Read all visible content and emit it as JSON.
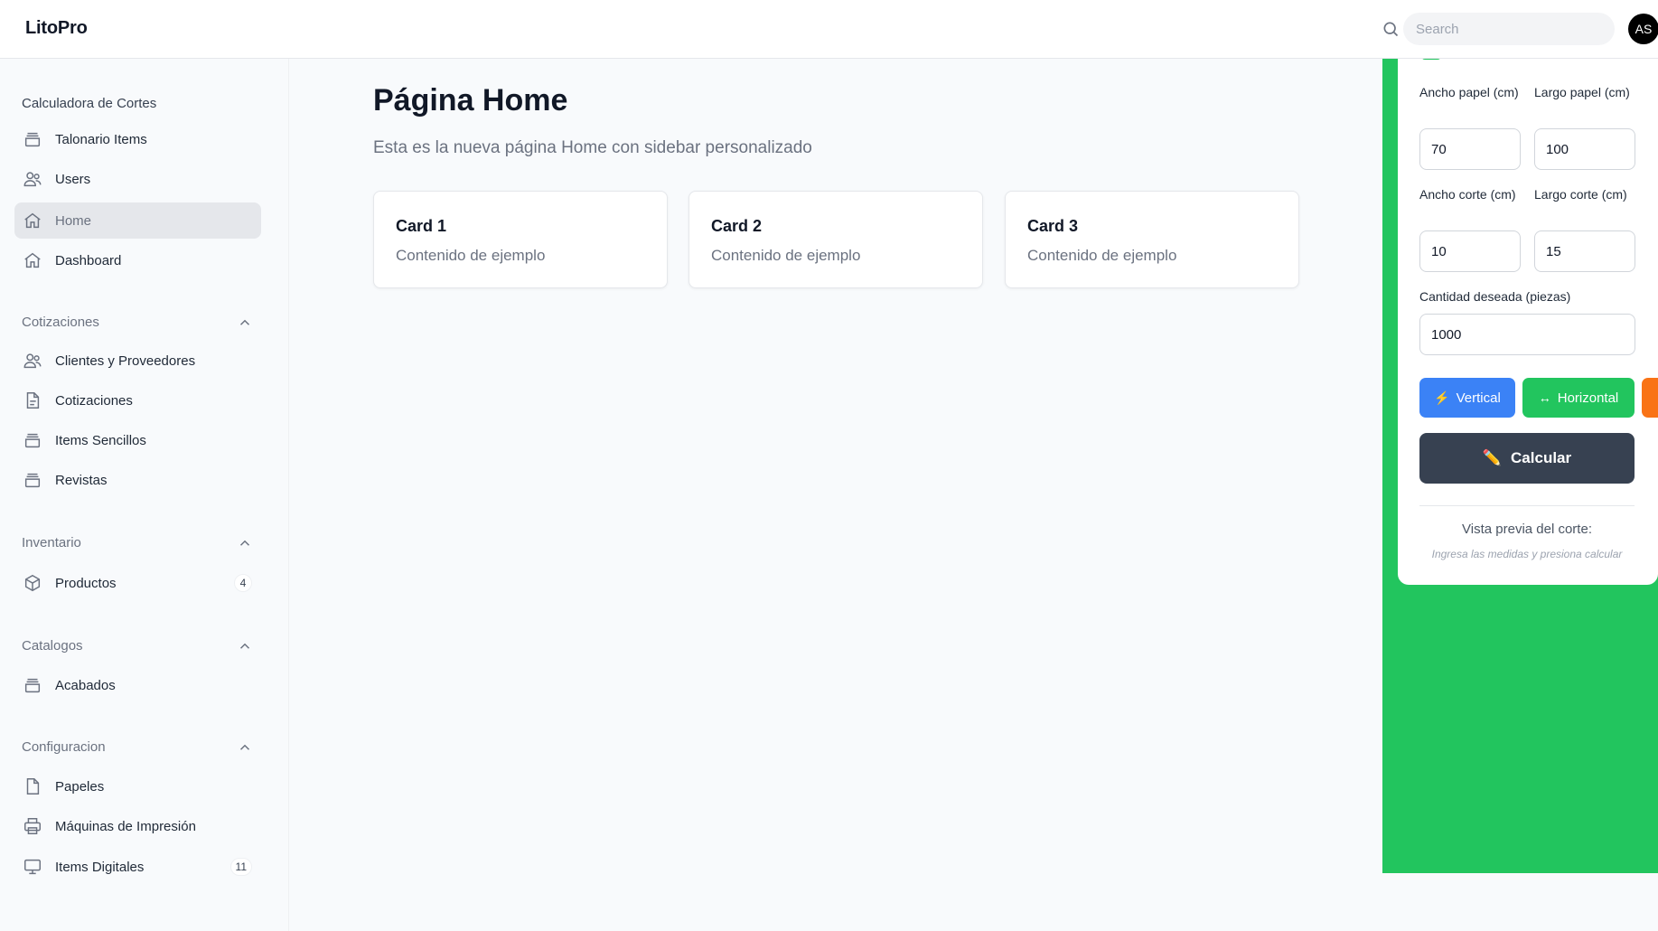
{
  "app": {
    "brand": "LitoPro"
  },
  "header": {
    "search_placeholder": "Search",
    "avatar_initials": "AS"
  },
  "sidebar": {
    "top_group_title": "Calculadora de Cortes",
    "top_items": [
      {
        "label": "Talonario Items",
        "icon": "archive-icon"
      },
      {
        "label": "Users",
        "icon": "users-icon"
      },
      {
        "label": "Home",
        "icon": "home-icon",
        "active": true
      },
      {
        "label": "Dashboard",
        "icon": "home-icon"
      }
    ],
    "groups": [
      {
        "label": "Cotizaciones",
        "items": [
          {
            "label": "Clientes y Proveedores",
            "icon": "users-icon"
          },
          {
            "label": "Cotizaciones",
            "icon": "document-icon"
          },
          {
            "label": "Items Sencillos",
            "icon": "archive-icon"
          },
          {
            "label": "Revistas",
            "icon": "archive-icon"
          }
        ]
      },
      {
        "label": "Inventario",
        "items": [
          {
            "label": "Productos",
            "icon": "cube-icon",
            "badge": "4"
          }
        ]
      },
      {
        "label": "Catalogos",
        "items": [
          {
            "label": "Acabados",
            "icon": "archive-icon"
          }
        ]
      },
      {
        "label": "Configuracion",
        "items": [
          {
            "label": "Papeles",
            "icon": "document-icon"
          },
          {
            "label": "Máquinas de Impresión",
            "icon": "printer-icon"
          },
          {
            "label": "Items Digitales",
            "icon": "monitor-icon",
            "badge": "11"
          }
        ]
      }
    ]
  },
  "main": {
    "title": "Página Home",
    "subtitle": "Esta es la nueva página Home con sidebar personalizado",
    "cards": [
      {
        "title": "Card 1",
        "text": "Contenido de ejemplo"
      },
      {
        "title": "Card 2",
        "text": "Contenido de ejemplo"
      },
      {
        "title": "Card 3",
        "text": "Contenido de ejemplo"
      }
    ]
  },
  "calculator": {
    "ancho_papel_label": "Ancho papel (cm)",
    "ancho_papel_value": "70",
    "largo_papel_label": "Largo papel (cm)",
    "largo_papel_value": "100",
    "ancho_corte_label": "Ancho corte (cm)",
    "ancho_corte_value": "10",
    "largo_corte_label": "Largo corte (cm)",
    "largo_corte_value": "15",
    "cantidad_label": "Cantidad deseada (piezas)",
    "cantidad_value": "1000",
    "vertical_label": "Vertical",
    "vertical_icon": "⚡",
    "horizontal_label": "Horizontal",
    "horizontal_icon": "↔",
    "calcular_label": "Calcular",
    "calcular_icon": "✏️",
    "preview_title": "Vista previa del corte:",
    "preview_hint": "Ingresa las medidas y presiona calcular",
    "colors": {
      "panel": "#22c55e",
      "vertical": "#3b82f6",
      "horizontal": "#22c55e",
      "extra": "#f97316",
      "calcular": "#374151"
    }
  }
}
